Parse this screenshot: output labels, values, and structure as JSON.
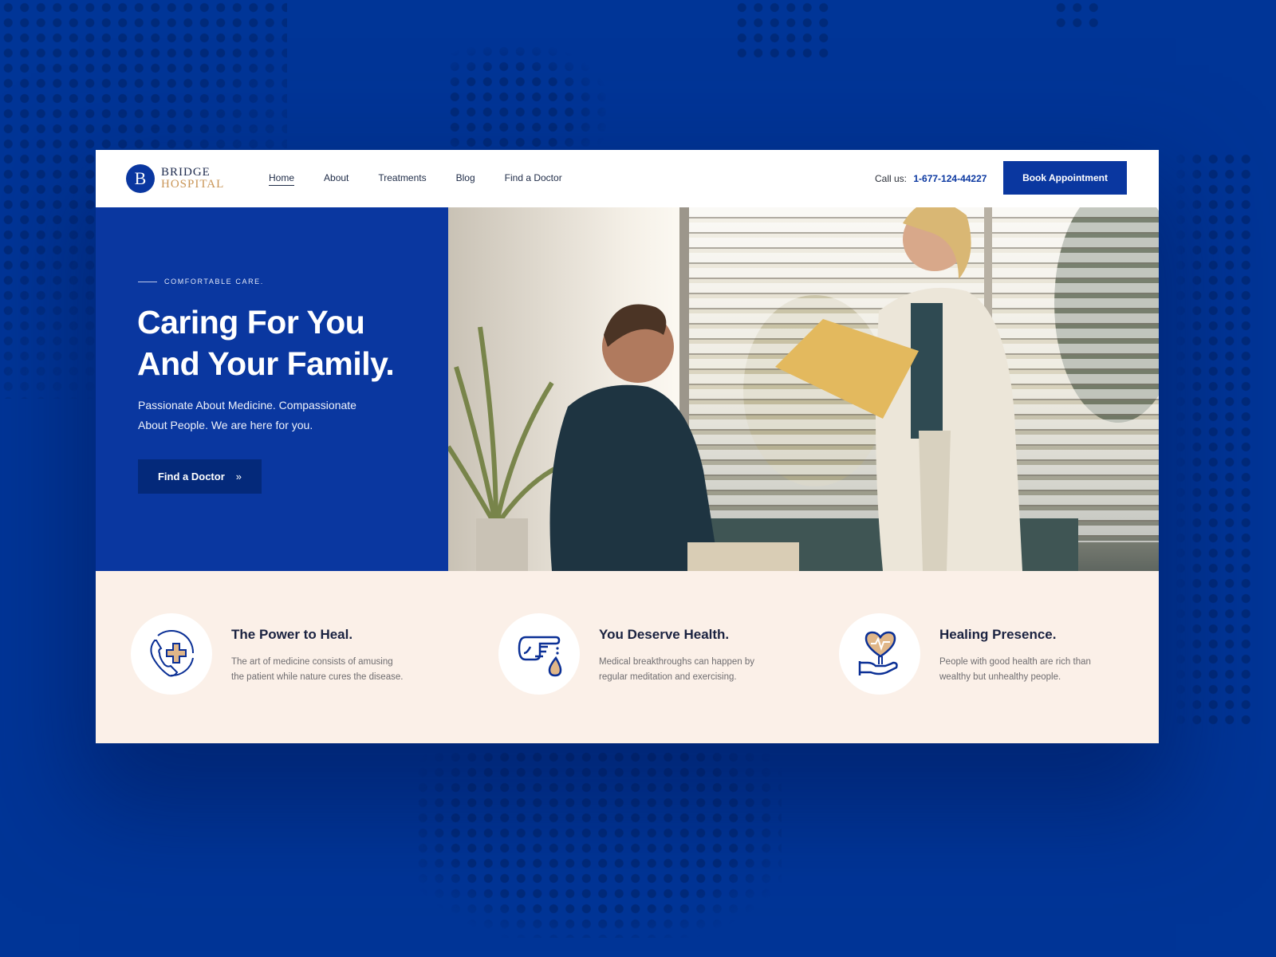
{
  "brand": {
    "logo_letter": "B",
    "name_line1": "BRIDGE",
    "name_line2": "HOSPITAL",
    "primary_color": "#0a37a0",
    "accent_color": "#c99556"
  },
  "nav": {
    "items": [
      {
        "label": "Home",
        "active": true
      },
      {
        "label": "About",
        "active": false
      },
      {
        "label": "Treatments",
        "active": false
      },
      {
        "label": "Blog",
        "active": false
      },
      {
        "label": "Find a Doctor",
        "active": false
      }
    ]
  },
  "header": {
    "call_label": "Call us:",
    "phone": "1-677-124-44227",
    "book_button": "Book Appointment"
  },
  "hero": {
    "eyebrow": "COMFORTABLE CARE.",
    "title_line1": "Caring For You",
    "title_line2": "And Your Family.",
    "subtitle_line1": "Passionate About Medicine. Compassionate",
    "subtitle_line2": "About People. We are here for you.",
    "cta_label": "Find a Doctor",
    "cta_icon": "double-chevron-right-icon",
    "image_description": "Smiling female doctor in white coat handing a yellow folder to a seated smiling man beside window blinds and a potted plant"
  },
  "features": [
    {
      "icon": "phone-medical-cross-icon",
      "title": "The Power to Heal.",
      "desc_line1": "The art of medicine consists of amusing",
      "desc_line2": "the patient while nature cures the disease."
    },
    {
      "icon": "finger-blood-drop-icon",
      "title": "You Deserve Health.",
      "desc_line1": "Medical breakthroughs can happen by",
      "desc_line2": "regular meditation and exercising."
    },
    {
      "icon": "hand-heart-pulse-icon",
      "title": "Healing Presence.",
      "desc_line1": "People with good health are rich than",
      "desc_line2": "wealthy but unhealthy people."
    }
  ]
}
